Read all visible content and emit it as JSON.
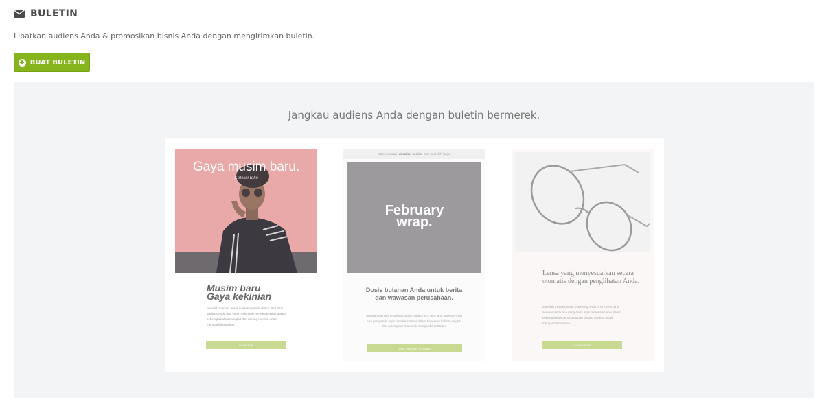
{
  "header": {
    "title": "BULETIN",
    "icon": "envelope-icon"
  },
  "intro": "Libatkan audiens Anda & promosikan bisnis Anda dengan mengirimkan buletin.",
  "create_button": {
    "label": "BUAT BULETIN",
    "icon": "plus-circle-icon",
    "color": "#86b41c"
  },
  "panel": {
    "title": "Jangkau audiens Anda dengan buletin bermerek.",
    "cards": [
      {
        "hero_title": "Gaya musim baru.",
        "hero_subtitle": "Koleksi toko",
        "headline_line1": "Musim baru",
        "headline_line2": "Gaya kekinian",
        "body": "Mulailah menulis email marketing Anda di sini. Beri tahu audiens Anda apa yang Anda ingin mereka ketahui dalam beberapa kalimat singkat dan dorong mereka untuk mengambil tindakan.",
        "cta": "DAPATKAN"
      },
      {
        "topbar_text": "Kami mencari",
        "topbar_bold": "desainer senior",
        "topbar_link": "Cari tau lebih lanjut",
        "hero_title_line1": "February",
        "hero_title_line2": "wrap.",
        "headline": "Dosis bulanan Anda untuk berita dan wawasan perusahaan.",
        "body": "Mulailah menulis email marketing Anda di sini. Beri tahu audiens Anda apa yang Anda ingin mereka ketahui dalam beberapa kalimat singkat dan dorong mereka untuk mengambil tindakan.",
        "cta": "LIHAT PROYEK TERBARU"
      },
      {
        "headline": "Lensa yang menyesuaikan secara otomatis dengan penglihatan Anda.",
        "body": "Mulailah menulis email marketing Anda di sini. Beri tahu audiens Anda apa yang Anda ingin mereka ketahui dalam beberapa kalimat singkat dan dorong mereka untuk mengambil tindakan.",
        "cta": "LEARN MORE"
      }
    ]
  },
  "colors": {
    "panel_bg": "#f3f4f6",
    "cta_bg": "#c8da92",
    "pink_hero": "#e9a9a9",
    "gray_hero": "#9d9a9e"
  }
}
